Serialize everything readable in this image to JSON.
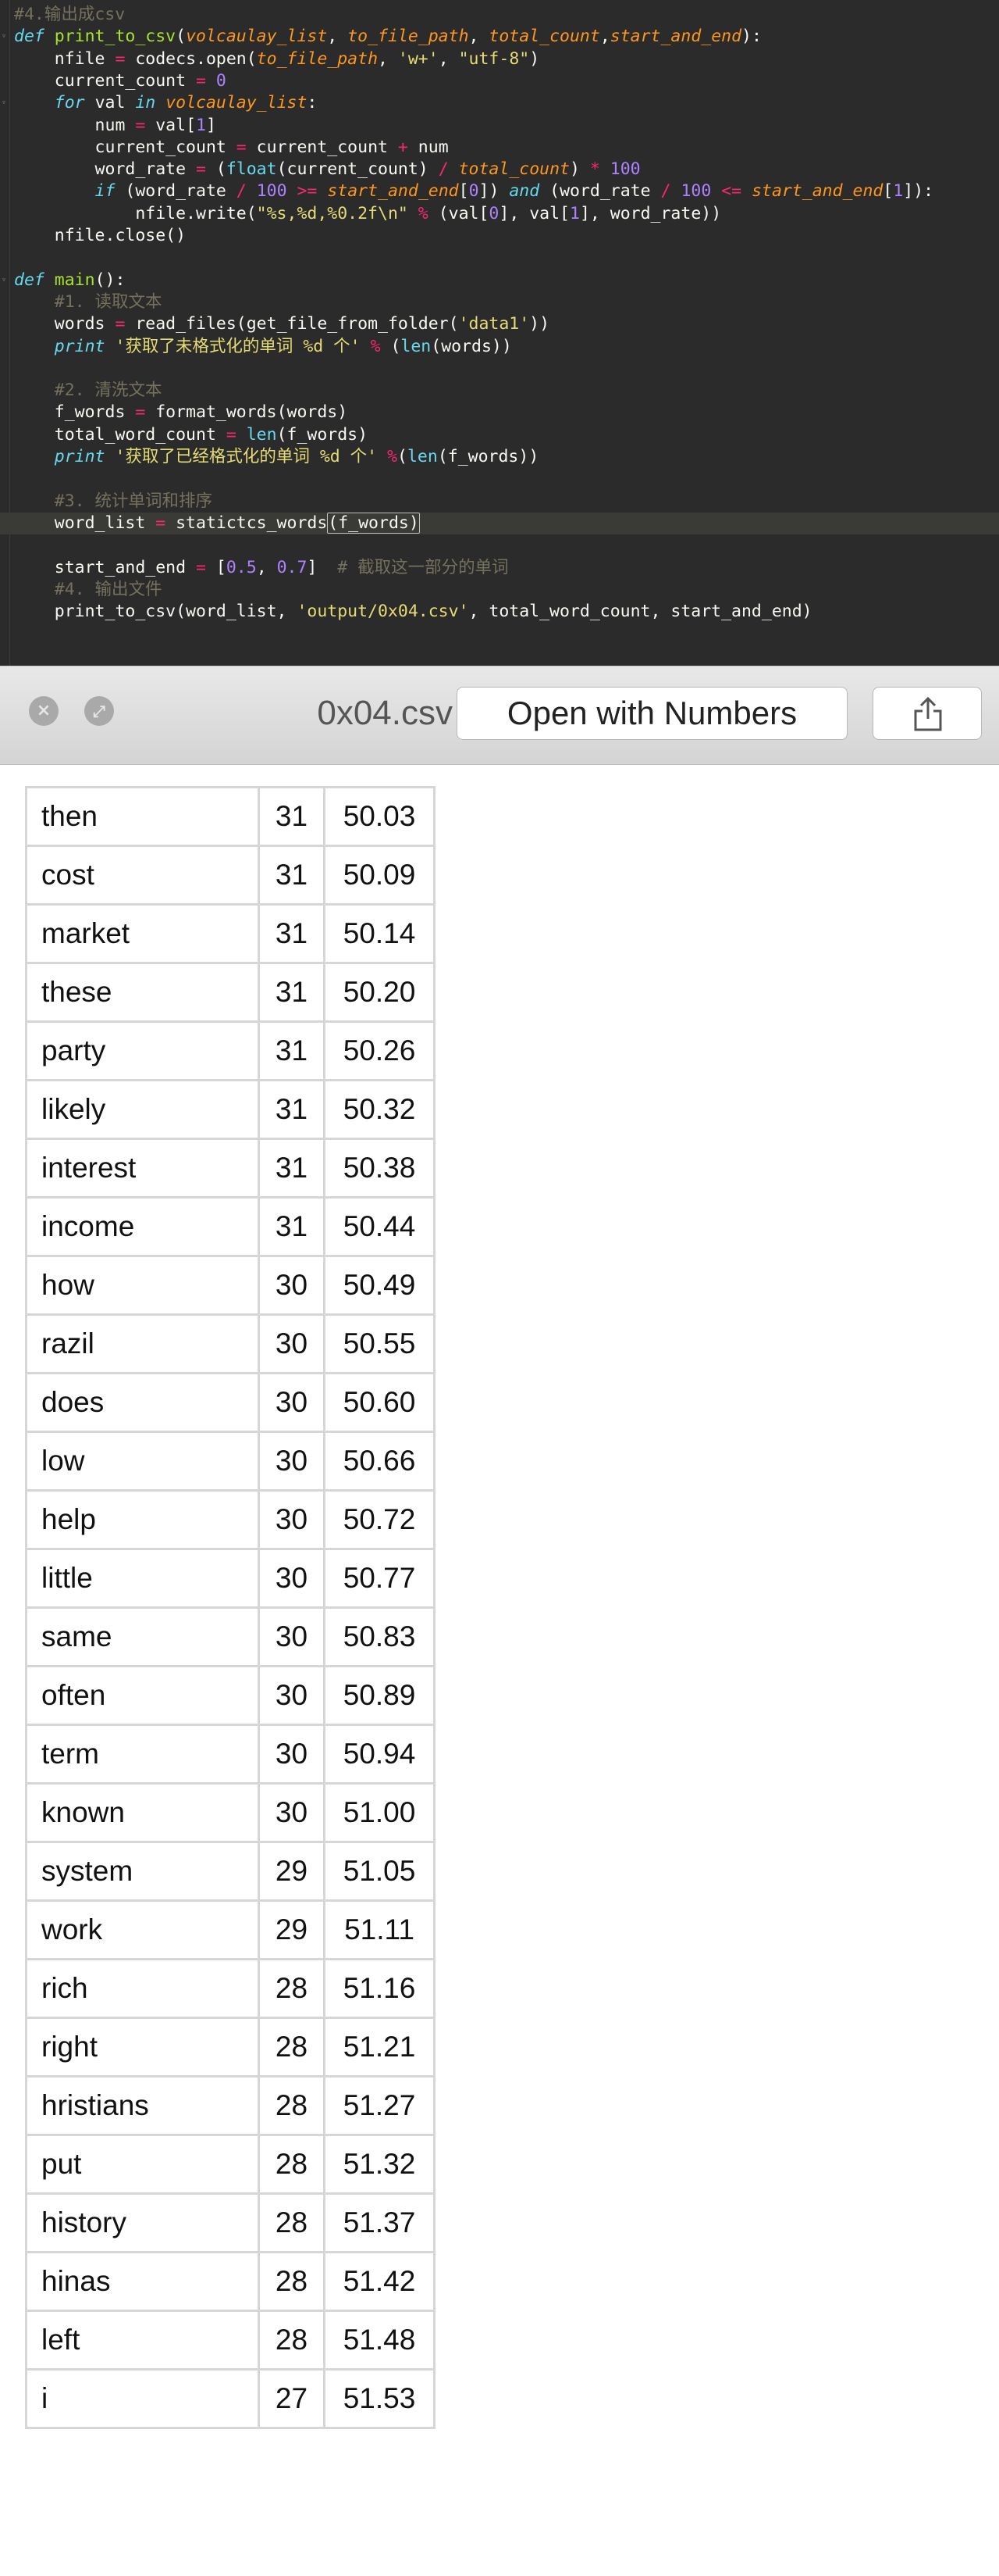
{
  "code": {
    "lines": [
      [
        [
          "cm",
          "#4.输出成csv"
        ]
      ],
      [
        [
          "kw",
          "def "
        ],
        [
          "fn",
          "print_to_csv"
        ],
        [
          "pl",
          "("
        ],
        [
          "pa",
          "volcaulay_list"
        ],
        [
          "pl",
          ", "
        ],
        [
          "pa",
          "to_file_path"
        ],
        [
          "pl",
          ", "
        ],
        [
          "pa",
          "total_count"
        ],
        [
          "pl",
          ","
        ],
        [
          "pa",
          "start_and_end"
        ],
        [
          "pl",
          "):"
        ]
      ],
      [
        [
          "pl",
          "    nfile "
        ],
        [
          "op",
          "="
        ],
        [
          "pl",
          " codecs.open("
        ],
        [
          "pa",
          "to_file_path"
        ],
        [
          "pl",
          ", "
        ],
        [
          "st",
          "'w+'"
        ],
        [
          "pl",
          ", "
        ],
        [
          "st",
          "\"utf-8\""
        ],
        [
          "pl",
          ")"
        ]
      ],
      [
        [
          "pl",
          "    current_count "
        ],
        [
          "op",
          "="
        ],
        [
          "pl",
          " "
        ],
        [
          "nu",
          "0"
        ]
      ],
      [
        [
          "kw",
          "    for "
        ],
        [
          "pl",
          "val "
        ],
        [
          "kw",
          "in "
        ],
        [
          "pa",
          "volcaulay_list"
        ],
        [
          "pl",
          ":"
        ]
      ],
      [
        [
          "pl",
          "        num "
        ],
        [
          "op",
          "="
        ],
        [
          "pl",
          " val["
        ],
        [
          "nu",
          "1"
        ],
        [
          "pl",
          "]"
        ]
      ],
      [
        [
          "pl",
          "        current_count "
        ],
        [
          "op",
          "="
        ],
        [
          "pl",
          " current_count "
        ],
        [
          "op",
          "+"
        ],
        [
          "pl",
          " num"
        ]
      ],
      [
        [
          "pl",
          "        word_rate "
        ],
        [
          "op",
          "="
        ],
        [
          "pl",
          " ("
        ],
        [
          "bi",
          "float"
        ],
        [
          "pl",
          "(current_count) "
        ],
        [
          "op",
          "/"
        ],
        [
          "pl",
          " "
        ],
        [
          "pa",
          "total_count"
        ],
        [
          "pl",
          ") "
        ],
        [
          "op",
          "*"
        ],
        [
          "pl",
          " "
        ],
        [
          "nu",
          "100"
        ]
      ],
      [
        [
          "kw",
          "        if "
        ],
        [
          "pl",
          "(word_rate "
        ],
        [
          "op",
          "/"
        ],
        [
          "pl",
          " "
        ],
        [
          "nu",
          "100"
        ],
        [
          "pl",
          " "
        ],
        [
          "op",
          ">="
        ],
        [
          "pl",
          " "
        ],
        [
          "pa",
          "start_and_end"
        ],
        [
          "pl",
          "["
        ],
        [
          "nu",
          "0"
        ],
        [
          "pl",
          "]) "
        ],
        [
          "kw",
          "and "
        ],
        [
          "pl",
          "(word_rate "
        ],
        [
          "op",
          "/"
        ],
        [
          "pl",
          " "
        ],
        [
          "nu",
          "100"
        ],
        [
          "pl",
          " "
        ],
        [
          "op",
          "<="
        ],
        [
          "pl",
          " "
        ],
        [
          "pa",
          "start_and_end"
        ],
        [
          "pl",
          "["
        ],
        [
          "nu",
          "1"
        ],
        [
          "pl",
          "]):"
        ]
      ],
      [
        [
          "pl",
          "            nfile.write("
        ],
        [
          "st",
          "\"%s,%d,%0.2f\\n\""
        ],
        [
          "pl",
          " "
        ],
        [
          "op",
          "%"
        ],
        [
          "pl",
          " (val["
        ],
        [
          "nu",
          "0"
        ],
        [
          "pl",
          "], val["
        ],
        [
          "nu",
          "1"
        ],
        [
          "pl",
          "], word_rate))"
        ]
      ],
      [
        [
          "pl",
          "    nfile.close()"
        ]
      ],
      [
        [
          "pl",
          ""
        ]
      ],
      [
        [
          "kw",
          "def "
        ],
        [
          "fn",
          "main"
        ],
        [
          "pl",
          "():"
        ]
      ],
      [
        [
          "cm",
          "    #1. 读取文本"
        ]
      ],
      [
        [
          "pl",
          "    words "
        ],
        [
          "op",
          "="
        ],
        [
          "pl",
          " read_files(get_file_from_folder("
        ],
        [
          "st",
          "'data1'"
        ],
        [
          "pl",
          "))"
        ]
      ],
      [
        [
          "kw",
          "    print "
        ],
        [
          "st",
          "'获取了未格式化的单词 %d 个'"
        ],
        [
          "pl",
          " "
        ],
        [
          "op",
          "%"
        ],
        [
          "pl",
          " ("
        ],
        [
          "bi",
          "len"
        ],
        [
          "pl",
          "(words))"
        ]
      ],
      [
        [
          "pl",
          ""
        ]
      ],
      [
        [
          "cm",
          "    #2. 清洗文本"
        ]
      ],
      [
        [
          "pl",
          "    f_words "
        ],
        [
          "op",
          "="
        ],
        [
          "pl",
          " format_words(words)"
        ]
      ],
      [
        [
          "pl",
          "    total_word_count "
        ],
        [
          "op",
          "="
        ],
        [
          "pl",
          " "
        ],
        [
          "bi",
          "len"
        ],
        [
          "pl",
          "(f_words)"
        ]
      ],
      [
        [
          "kw",
          "    print "
        ],
        [
          "st",
          "'获取了已经格式化的单词 %d 个'"
        ],
        [
          "pl",
          " "
        ],
        [
          "op",
          "%"
        ],
        [
          "pl",
          "("
        ],
        [
          "bi",
          "len"
        ],
        [
          "pl",
          "(f_words))"
        ]
      ],
      [
        [
          "pl",
          ""
        ]
      ],
      [
        [
          "cm",
          "    #3. 统计单词和排序"
        ]
      ],
      [
        [
          "pl",
          "    word_list "
        ],
        [
          "op",
          "="
        ],
        [
          "pl",
          " statictcs_words"
        ],
        [
          "sel",
          "(f_words)"
        ]
      ],
      [
        [
          "pl",
          ""
        ]
      ],
      [
        [
          "pl",
          "    start_and_end "
        ],
        [
          "op",
          "="
        ],
        [
          "pl",
          " ["
        ],
        [
          "nu",
          "0.5"
        ],
        [
          "pl",
          ", "
        ],
        [
          "nu",
          "0.7"
        ],
        [
          "pl",
          "]  "
        ],
        [
          "cm",
          "# 截取这一部分的单词"
        ]
      ],
      [
        [
          "cm",
          "    #4. 输出文件"
        ]
      ],
      [
        [
          "pl",
          "    print_to_csv(word_list, "
        ],
        [
          "st",
          "'output/0x04.csv'"
        ],
        [
          "pl",
          ", total_word_count, start_and_end)"
        ]
      ]
    ]
  },
  "quicklook": {
    "title": "0x04.csv",
    "open_label": "Open with Numbers",
    "close_glyph": "×",
    "fullscreen_glyph": "⤢"
  },
  "table": {
    "rows": [
      [
        "then",
        "31",
        "50.03"
      ],
      [
        "cost",
        "31",
        "50.09"
      ],
      [
        "market",
        "31",
        "50.14"
      ],
      [
        "these",
        "31",
        "50.20"
      ],
      [
        "party",
        "31",
        "50.26"
      ],
      [
        "likely",
        "31",
        "50.32"
      ],
      [
        "interest",
        "31",
        "50.38"
      ],
      [
        "income",
        "31",
        "50.44"
      ],
      [
        "how",
        "30",
        "50.49"
      ],
      [
        "razil",
        "30",
        "50.55"
      ],
      [
        "does",
        "30",
        "50.60"
      ],
      [
        "low",
        "30",
        "50.66"
      ],
      [
        "help",
        "30",
        "50.72"
      ],
      [
        "little",
        "30",
        "50.77"
      ],
      [
        "same",
        "30",
        "50.83"
      ],
      [
        "often",
        "30",
        "50.89"
      ],
      [
        "term",
        "30",
        "50.94"
      ],
      [
        "known",
        "30",
        "51.00"
      ],
      [
        "system",
        "29",
        "51.05"
      ],
      [
        "work",
        "29",
        "51.11"
      ],
      [
        "rich",
        "28",
        "51.16"
      ],
      [
        "right",
        "28",
        "51.21"
      ],
      [
        "hristians",
        "28",
        "51.27"
      ],
      [
        "put",
        "28",
        "51.32"
      ],
      [
        "history",
        "28",
        "51.37"
      ],
      [
        "hinas",
        "28",
        "51.42"
      ],
      [
        "left",
        "28",
        "51.48"
      ],
      [
        "i",
        "27",
        "51.53"
      ]
    ]
  },
  "colors": {
    "editor_bg": "#2b2b2b",
    "keyword": "#66d9ef",
    "function": "#a6e22e",
    "param": "#fd971f",
    "operator": "#f92672",
    "number": "#ae81ff",
    "string": "#e6db74",
    "comment": "#75715e"
  }
}
